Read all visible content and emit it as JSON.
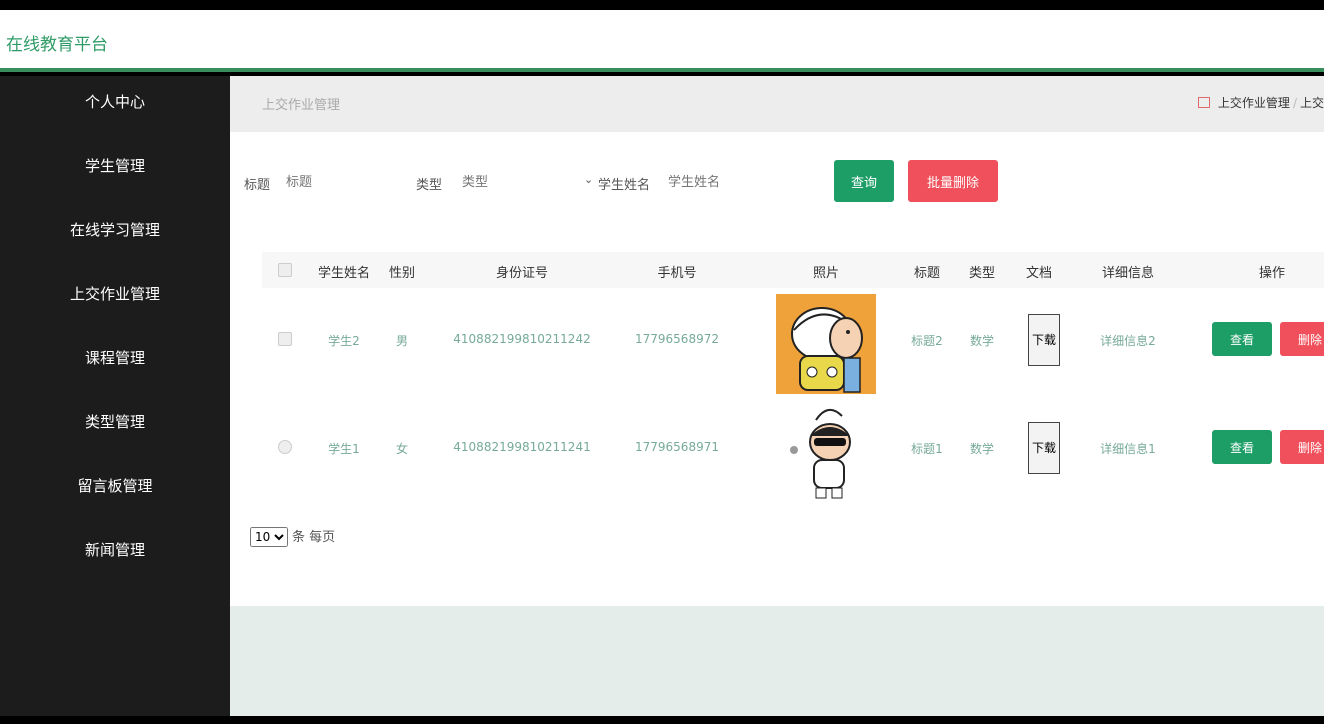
{
  "app": {
    "title": "在线教育平台"
  },
  "sidebar": {
    "items": [
      {
        "label": "个人中心"
      },
      {
        "label": "学生管理"
      },
      {
        "label": "在线学习管理"
      },
      {
        "label": "上交作业管理"
      },
      {
        "label": "课程管理"
      },
      {
        "label": "类型管理"
      },
      {
        "label": "留言板管理"
      },
      {
        "label": "新闻管理"
      }
    ]
  },
  "breadcrumb": {
    "title": "上交作业管理",
    "path": [
      "上交作业管理",
      "上交"
    ]
  },
  "filters": {
    "title_label": "标题",
    "title_placeholder": "标题",
    "type_label": "类型",
    "type_placeholder": "类型",
    "student_label": "学生姓名",
    "student_placeholder": "学生姓名",
    "query_button": "查询",
    "batch_delete_button": "批量删除"
  },
  "table": {
    "columns": [
      "学生姓名",
      "性别",
      "身份证号",
      "手机号",
      "照片",
      "标题",
      "类型",
      "文档",
      "详细信息",
      "操作"
    ],
    "rows": [
      {
        "name": "学生2",
        "gender": "男",
        "id_number": "410882199810211242",
        "phone": "17796568972",
        "photo": "avatar-crayon-kid-backpack",
        "title": "标题2",
        "type": "数学",
        "doc_button": "下载",
        "detail": "详细信息2",
        "view_button": "查看",
        "delete_button": "删除"
      },
      {
        "name": "学生1",
        "gender": "女",
        "id_number": "410882199810211241",
        "phone": "17796568971",
        "photo": "avatar-crayon-kid-sunglasses",
        "title": "标题1",
        "type": "数学",
        "doc_button": "下载",
        "detail": "详细信息1",
        "view_button": "查看",
        "delete_button": "删除"
      }
    ]
  },
  "pagination": {
    "page_size": "10",
    "page_size_suffix": "条 每页"
  },
  "colors": {
    "brand": "#2f9b66",
    "accent_bar": "#3a8d5c",
    "primary_button": "#1e9e67",
    "danger_button": "#f0505b",
    "sidebar_bg": "#1c1c1c"
  }
}
